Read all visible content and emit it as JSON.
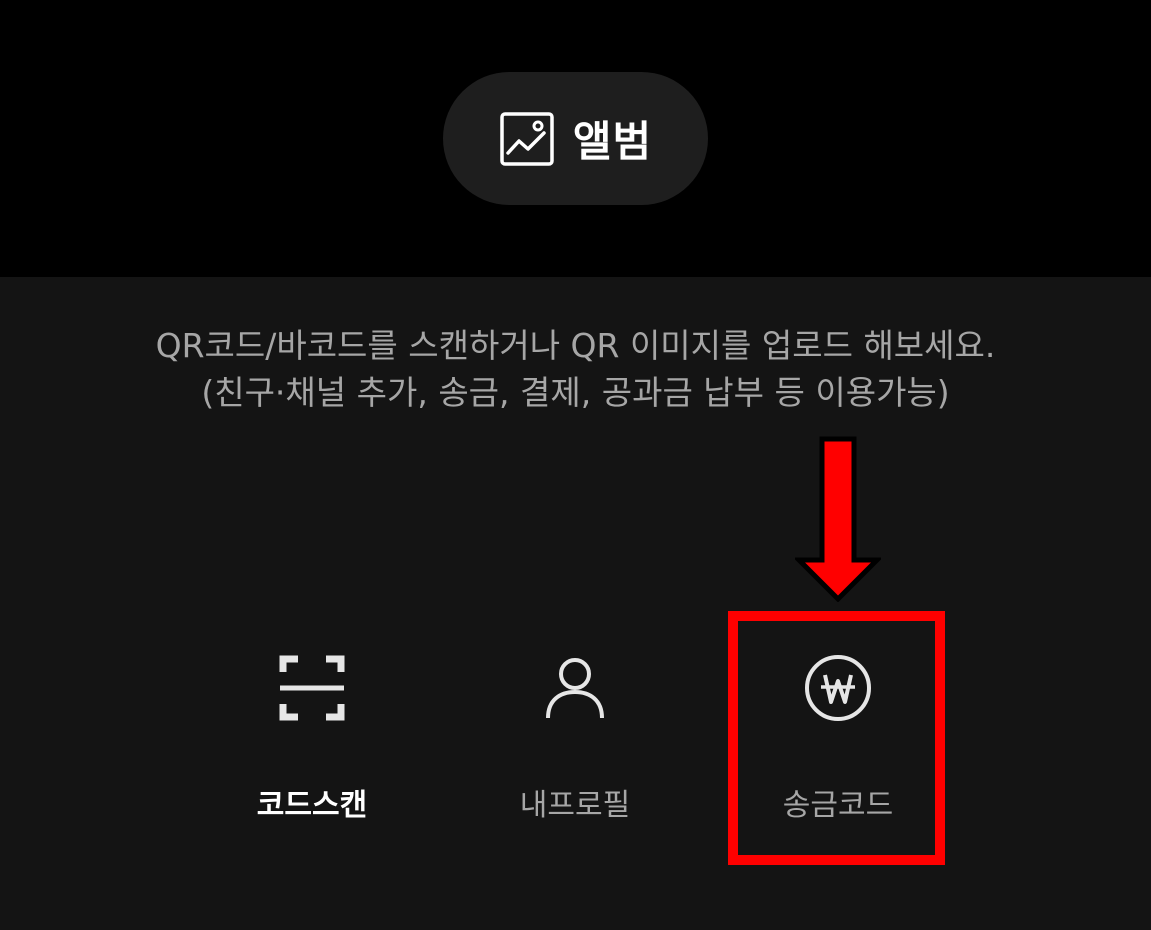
{
  "album": {
    "label": "앨범",
    "icon": "image-icon"
  },
  "description": {
    "line1": "QR코드/바코드를 스캔하거나 QR 이미지를 업로드 해보세요.",
    "line2": "(친구·채널 추가, 송금, 결제, 공과금 납부 등 이용가능)"
  },
  "tabs": [
    {
      "label": "코드스캔",
      "icon": "scan-frame-icon",
      "active": true
    },
    {
      "label": "내프로필",
      "icon": "person-icon",
      "active": false
    },
    {
      "label": "송금코드",
      "icon": "won-circle-icon",
      "active": false
    }
  ],
  "colors": {
    "top_background": "#000000",
    "bottom_background": "#141414",
    "album_button": "#1e1e1e",
    "active_text": "#ffffff",
    "inactive_text": "#a6a6a6",
    "annotation": "#ff0000"
  }
}
